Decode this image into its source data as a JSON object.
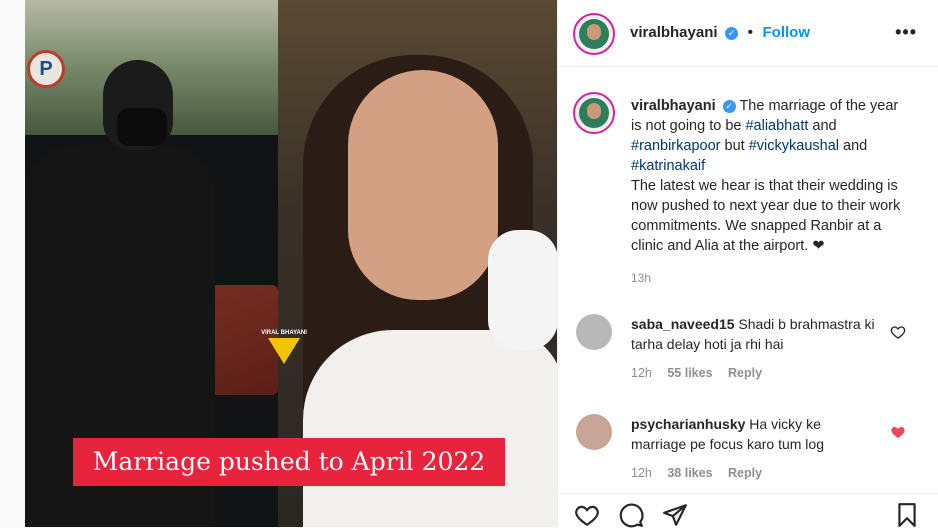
{
  "post": {
    "username": "viralbhayani",
    "follow_label": "Follow",
    "more_icon": "•••",
    "verified_icon": "✓",
    "caption": {
      "username": "viralbhayani",
      "text_1": "The marriage of the year is not going to be",
      "tag_1": "#aliabhatt",
      "text_2": "and",
      "tag_2": "#ranbirkapoor",
      "text_3": "but",
      "tag_3": "#vickykaushal",
      "text_4": "and",
      "tag_4": "#katrinakaif",
      "text_5": "The latest we hear is that their wedding is now pushed to next year due to their work commitments. We snapped Ranbir at a clinic and Alia at the airport. ❤",
      "time": "13h"
    },
    "media": {
      "banner_text": "Marriage pushed to April 2022",
      "watermark": "VIRAL BHAYANI",
      "parking_sign": "P"
    },
    "comments": [
      {
        "username": "saba_naveed15",
        "text": "Shadi b brahmastra ki tarha delay hoti ja rhi hai",
        "time": "12h",
        "likes": "55 likes",
        "reply": "Reply",
        "liked": false
      },
      {
        "username": "psycharianhusky",
        "text": "Ha vicky ke marriage pe focus karo tum log",
        "time": "12h",
        "likes": "38 likes",
        "reply": "Reply",
        "liked": true
      }
    ],
    "colors": {
      "accent": "#0095f6",
      "heart_liked": "#ed4956",
      "banner": "#e8243c"
    },
    "icons": [
      "heart-icon",
      "comment-icon",
      "share-icon",
      "bookmark-icon"
    ]
  }
}
